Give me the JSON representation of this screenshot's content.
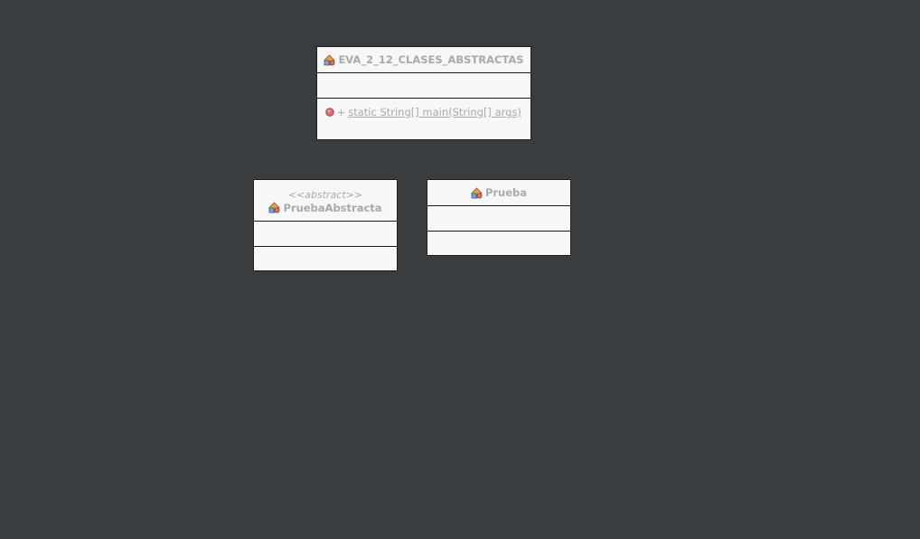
{
  "diagram": {
    "classes": [
      {
        "id": "main",
        "stereotype": "",
        "name": "EVA_2_12_CLASES_ABSTRACTAS",
        "attributes": [],
        "methods": [
          {
            "visibility": "+",
            "signature": "static String[] main(String[] args)",
            "icon": "public-method-icon"
          }
        ]
      },
      {
        "id": "abstract",
        "stereotype": "<<abstract>>",
        "name": "PruebaAbstracta",
        "attributes": [],
        "methods": []
      },
      {
        "id": "prueba",
        "stereotype": "",
        "name": "Prueba",
        "attributes": [],
        "methods": []
      }
    ],
    "colors": {
      "canvas": "#3a3d40",
      "box_fill": "#f7f7f7",
      "border": "#1a1a1a",
      "text": "#a9a9a9"
    }
  }
}
